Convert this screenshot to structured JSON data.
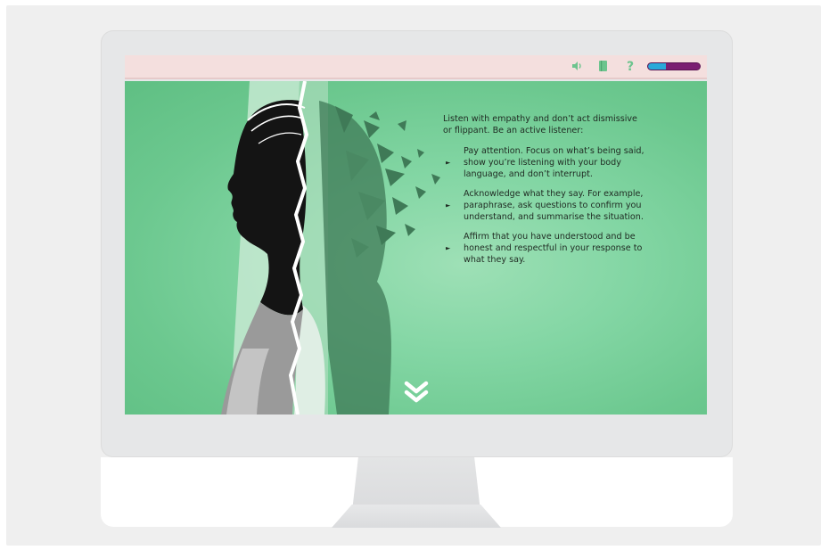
{
  "colors": {
    "stage_green": "#6cc88f",
    "topbar_pink": "#f4dfde",
    "icon_green": "#6dc48e",
    "progress_fill": "#29a9d9",
    "progress_track": "#7b1f72"
  },
  "toolbar": {
    "audio_icon": "speaker-icon",
    "book_icon": "book-icon",
    "help_label": "?",
    "progress": 0.35
  },
  "slide": {
    "intro": "Listen with empathy and don’t act dismissive or flippant. Be an active listener:",
    "bullets": [
      "Pay attention. Focus on what’s being said, show you’re listening with your body language, and don’t interrupt.",
      "Acknowledge what they say. For example, paraphrase, ask questions to confirm you understand, and summarise the situation.",
      "Affirm that you have understood and be honest and respectful in your response to what they say."
    ],
    "next_icon": "double-chevron-down-icon"
  }
}
